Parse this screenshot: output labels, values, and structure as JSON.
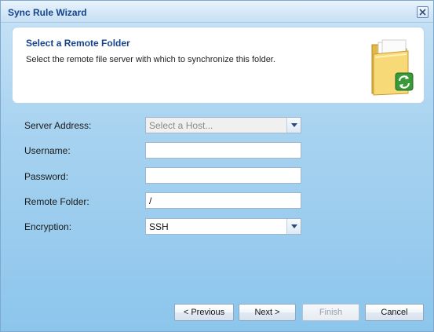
{
  "window": {
    "title": "Sync Rule Wizard"
  },
  "header": {
    "title": "Select a Remote Folder",
    "description": "Select the remote file server with which to synchronize this folder."
  },
  "form": {
    "server_address": {
      "label": "Server Address:",
      "placeholder": "Select a Host...",
      "value": ""
    },
    "username": {
      "label": "Username:",
      "value": ""
    },
    "password": {
      "label": "Password:",
      "value": ""
    },
    "remote_folder": {
      "label": "Remote Folder:",
      "value": "/"
    },
    "encryption": {
      "label": "Encryption:",
      "value": "SSH"
    }
  },
  "buttons": {
    "previous": "< Previous",
    "next": "Next >",
    "finish": "Finish",
    "cancel": "Cancel"
  },
  "icons": {
    "close": "close-icon",
    "folder_sync": "folder-sync-icon",
    "dropdown": "chevron-down-icon"
  },
  "colors": {
    "title_text": "#15428b",
    "window_background": "#a8d3f0"
  }
}
